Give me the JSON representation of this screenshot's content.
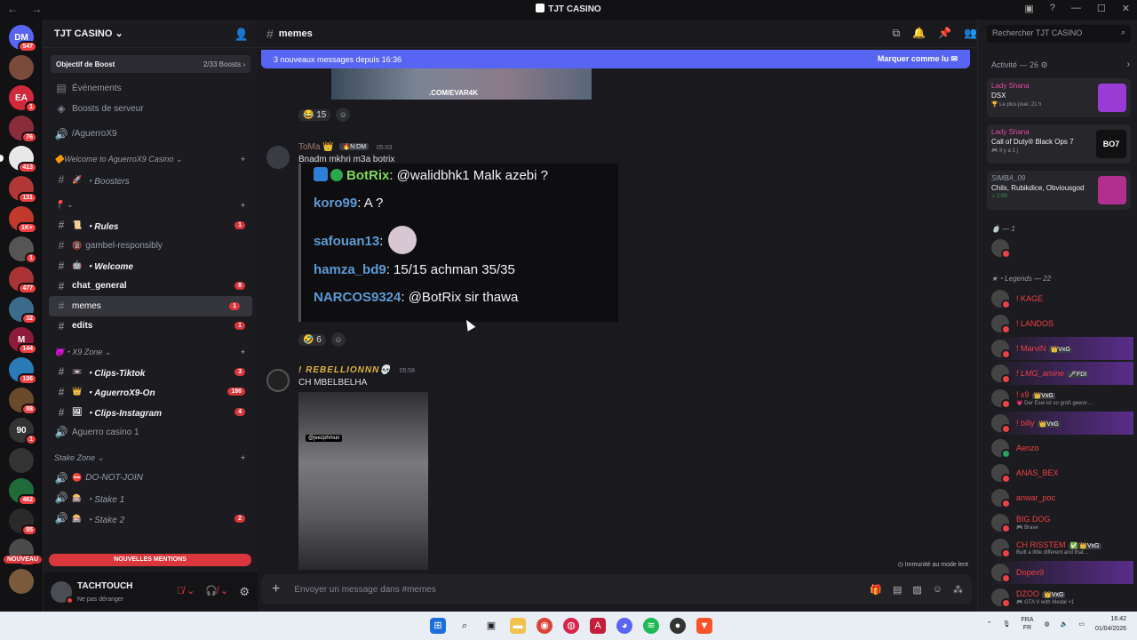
{
  "window": {
    "title": "TJT CASINO"
  },
  "guilds": [
    {
      "badge": "547",
      "label": "DM",
      "color": "#5865f2"
    },
    {
      "badge": "",
      "label": "",
      "color": "#7a4a3a"
    },
    {
      "badge": "1",
      "label": "EA",
      "color": "#d1283c"
    },
    {
      "badge": "76",
      "label": "",
      "color": "#8a2c3a"
    },
    {
      "badge": "413",
      "label": "",
      "color": "#e8e8e8"
    },
    {
      "badge": "131",
      "label": "",
      "color": "#b33636"
    },
    {
      "badge": "1K+",
      "label": "",
      "color": "#c0392b"
    },
    {
      "badge": "1",
      "label": "",
      "color": "#555"
    },
    {
      "badge": "477",
      "label": "",
      "color": "#a33"
    },
    {
      "badge": "32",
      "label": "",
      "color": "#3a6b8a"
    },
    {
      "badge": "144",
      "label": "M",
      "color": "#8e1b3a"
    },
    {
      "badge": "106",
      "label": "",
      "color": "#2a7ab8"
    },
    {
      "badge": "88",
      "label": "",
      "color": "#6a4a2a"
    },
    {
      "badge": "1",
      "label": "90",
      "color": "#333"
    },
    {
      "badge": "",
      "label": "",
      "color": "#333"
    },
    {
      "badge": "462",
      "label": "",
      "color": "#1f6b3a"
    },
    {
      "badge": "85",
      "label": "",
      "color": "#2a2a2a"
    },
    {
      "badge": "539",
      "label": "",
      "color": "#4a4a4a"
    },
    {
      "badge": "",
      "label": "",
      "color": "#7a5a3a"
    }
  ],
  "nouveau_label": "NOUVEAU",
  "server": {
    "name": "TJT CASINO ⌄",
    "boost_label": "Objectif de Boost",
    "boost_count": "2/33 Boosts ›",
    "channels": [
      {
        "type": "link",
        "icon": "▤",
        "label": "Événements",
        "style": "plain"
      },
      {
        "type": "link",
        "icon": "◈",
        "label": "Boosts de serveur",
        "style": "plain"
      },
      {
        "type": "gap"
      },
      {
        "type": "voice",
        "icon": "🔊",
        "label": "/AguerroX9",
        "style": "plain"
      },
      {
        "type": "gap"
      },
      {
        "type": "cat",
        "label": "🔶Welcome to AguerroX9 Casino ⌄"
      },
      {
        "type": "text",
        "icon": "#",
        "em": "🚀",
        "label": "・Boosters",
        "style": "it"
      },
      {
        "type": "gap"
      },
      {
        "type": "cat",
        "label": "📍 ⌄"
      },
      {
        "type": "text",
        "icon": "#",
        "em": "📜",
        "label": "・Rules",
        "style": "it unread",
        "count": "1"
      },
      {
        "type": "text",
        "icon": "#",
        "em": "🔞",
        "label": "gambel-responsibly",
        "style": "plain"
      },
      {
        "type": "text",
        "icon": "#",
        "em": "🤖",
        "label": "・Welcome",
        "style": "it unread"
      },
      {
        "type": "text",
        "icon": "#",
        "label": "chat_general",
        "style": "unread",
        "count": "8"
      },
      {
        "type": "text",
        "icon": "#",
        "label": "memes",
        "style": "active",
        "count": "1"
      },
      {
        "type": "text",
        "icon": "#",
        "label": "edits",
        "style": "unread",
        "count": "1"
      },
      {
        "type": "gap"
      },
      {
        "type": "cat",
        "label": "😈・X9 Zone ⌄"
      },
      {
        "type": "text",
        "icon": "#",
        "em": "📼",
        "label": "・Clips-Tiktok",
        "style": "it unread",
        "count": "3"
      },
      {
        "type": "text",
        "icon": "#",
        "em": "👑",
        "label": "・AguerroX9-On",
        "style": "it unread",
        "count": "186"
      },
      {
        "type": "text",
        "icon": "#",
        "em": "🖼",
        "label": "・Clips-Instagram",
        "style": "it unread",
        "count": "4"
      },
      {
        "type": "voice",
        "icon": "🔊",
        "label": "Aguerro casino 1",
        "style": "plain"
      },
      {
        "type": "gap"
      },
      {
        "type": "cat",
        "label": "Stake Zone ⌄"
      },
      {
        "type": "voice",
        "icon": "🔊",
        "em": "⛔",
        "label": "DO-NOT-JOIN",
        "style": "it"
      },
      {
        "type": "voice",
        "icon": "🔊",
        "em": "🎰",
        "label": "・Stake 1",
        "style": "it"
      },
      {
        "type": "voice",
        "icon": "🔊",
        "em": "🎰",
        "label": "・Stake 2",
        "style": "it",
        "count": "2"
      }
    ],
    "new_mentions": "NOUVELLES MENTIONS"
  },
  "user": {
    "name": "TACHTOUCH",
    "status": "Ne pas déranger"
  },
  "channel": {
    "name": "memes",
    "banner_left": "3 nouveaux messages depuis 16:36",
    "banner_right": "Marquer comme lu",
    "img_watermark": ".COM/EVAR4K",
    "react1": {
      "emoji": "😂",
      "count": "15"
    },
    "msg1": {
      "author": "ToMa",
      "crown": "👑",
      "tag": "🔥N:DM",
      "time": "05:03",
      "text": "Bnadm mkhri m3a botrix"
    },
    "quote": [
      {
        "user": "BotRix",
        "text": ": @walidbhk1 Malk azebi ?",
        "bot": true
      },
      {
        "user": "koro99",
        "text": ": A ?"
      },
      {
        "user": "safouan13",
        "text": ":",
        "face": true
      },
      {
        "user": "hamza_bd9",
        "text": ": 15/15 achman 35/35"
      },
      {
        "user": "NARCOS9324",
        "text": ": @BotRix sir thawa"
      }
    ],
    "react2": {
      "emoji": "🤣",
      "count": "6"
    },
    "msg2": {
      "author": "! REBELLIONNN💀",
      "time": "05:58",
      "text": "CH MBELBELHA",
      "photo_tag": "@jeezphmun"
    },
    "composer_placeholder": "Envoyer un message dans #memes",
    "immunity": "Immunité au mode lent"
  },
  "right": {
    "search_placeholder": "Rechercher TJT CASINO",
    "activity_header": "Activité — 26 ⚙",
    "cards": [
      {
        "name": "Lady Shana",
        "title": "DSX",
        "sub": "🏆 Le plus joué: 21 h",
        "img": "pur"
      },
      {
        "name": "Lady Shana",
        "title": "Call of Duty® Black Ops 7",
        "sub": "🎮 Il y a 1 j",
        "img": "bo",
        "imgtxt": "BO7"
      },
      {
        "name": "SIMBA_09",
        "title": "Chilx, Rubikdice, Obviousgod",
        "sub": "♫ 2:00",
        "img": "pk",
        "grey": true,
        "green": true
      }
    ],
    "group1": "🍵 — 1",
    "group2": "★・Legends — 22",
    "members": [
      {
        "name": "! KAGE"
      },
      {
        "name": "! LANDOS"
      },
      {
        "name": "! MarviN",
        "tag": "👑VxG",
        "hl": true
      },
      {
        "name": "! LMG_amine",
        "tag": "🗡FDI",
        "hl": true,
        "it": true
      },
      {
        "name": "! x9",
        "tag": "👑VxG",
        "sub": "💗 Der Esel ist so groß gewor…"
      },
      {
        "name": "! billy",
        "tag": "👑VxG",
        "hl": true
      },
      {
        "name": "Aenzo",
        "on": true
      },
      {
        "name": "ANAS_BEX"
      },
      {
        "name": "anwar_poc"
      },
      {
        "name": "BIG DOG",
        "sub": "🎮 Brave"
      },
      {
        "name": "CH RISSTEM",
        "tag": "✅ 👑VxG",
        "sub": "Built a little different and that…"
      },
      {
        "name": "Dopex9",
        "hl": true
      },
      {
        "name": "DZOO",
        "tag": "👑VxG",
        "sub": "🎮 GTA V with Medal +1"
      }
    ]
  },
  "taskbar": {
    "lang1": "FRA",
    "lang2": "FR",
    "time": "16:42",
    "date": "01/04/2026"
  }
}
